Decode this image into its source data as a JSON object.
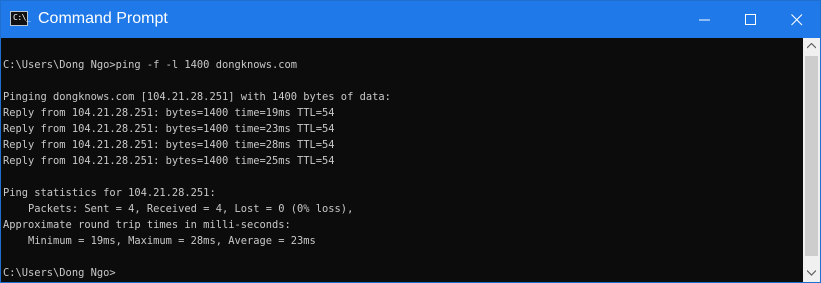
{
  "window": {
    "title": "Command Prompt",
    "icon": "command-prompt-icon",
    "icon_glyph": "C:\\_",
    "controls": [
      "minimize-icon",
      "maximize-icon",
      "close-icon"
    ]
  },
  "console": {
    "lines": [
      "C:\\Users\\Dong Ngo>ping -f -l 1400 dongknows.com",
      "",
      "Pinging dongknows.com [104.21.28.251] with 1400 bytes of data:",
      "Reply from 104.21.28.251: bytes=1400 time=19ms TTL=54",
      "Reply from 104.21.28.251: bytes=1400 time=23ms TTL=54",
      "Reply from 104.21.28.251: bytes=1400 time=28ms TTL=54",
      "Reply from 104.21.28.251: bytes=1400 time=25ms TTL=54",
      "",
      "Ping statistics for 104.21.28.251:",
      "    Packets: Sent = 4, Received = 4, Lost = 0 (0% loss),",
      "Approximate round trip times in milli-seconds:",
      "    Minimum = 19ms, Maximum = 28ms, Average = 23ms",
      "",
      "C:\\Users\\Dong Ngo>"
    ]
  },
  "colors": {
    "titlebar": "#1f79e8",
    "console_bg": "#0c0c0c",
    "console_text": "#c8c8c8"
  }
}
